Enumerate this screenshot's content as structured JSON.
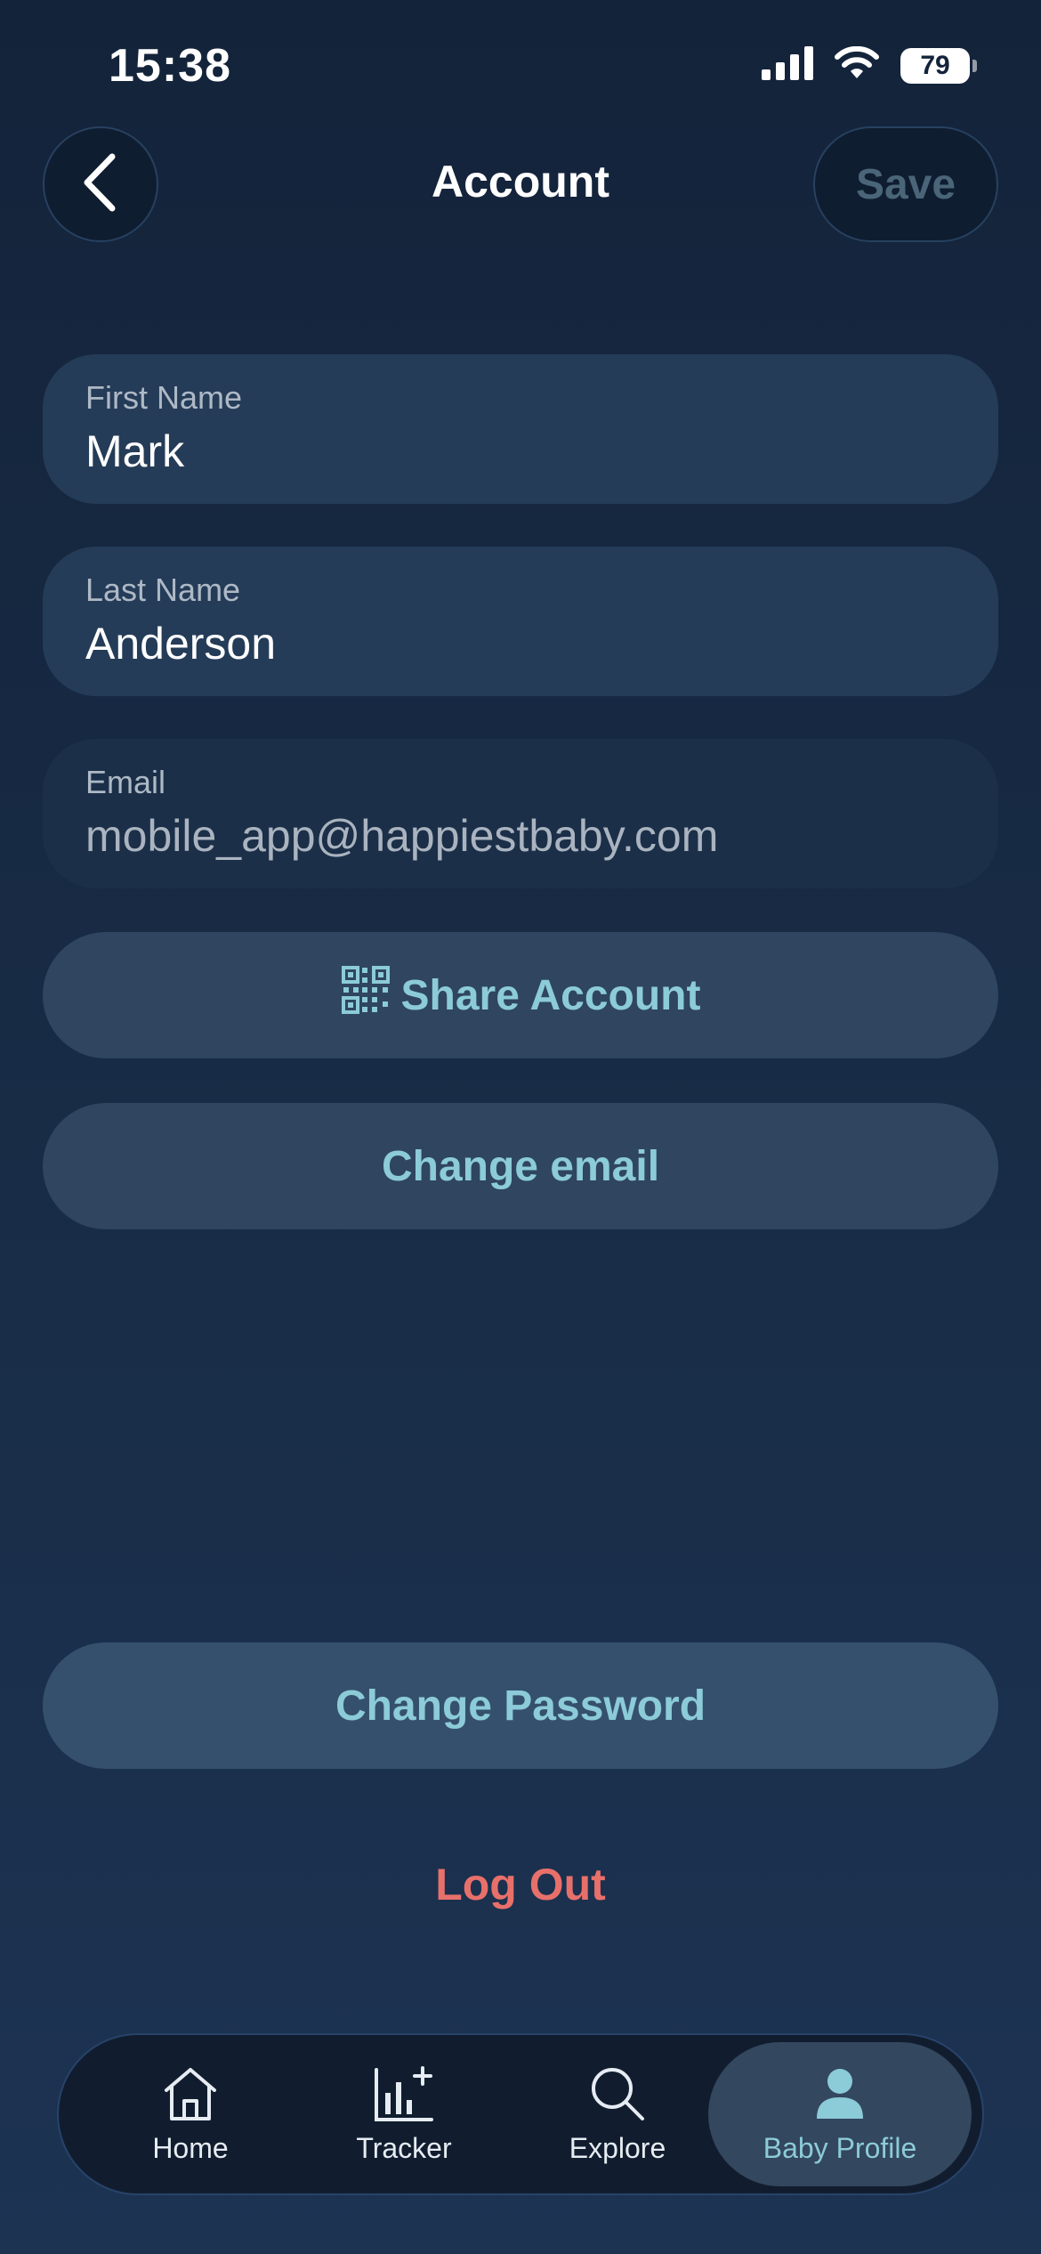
{
  "status_bar": {
    "time": "15:38",
    "battery": "79",
    "icons": [
      "cellular-signal-icon",
      "wifi-icon",
      "battery-icon"
    ]
  },
  "header": {
    "title": "Account",
    "save_label": "Save",
    "back_icon": "chevron-left-icon"
  },
  "form": {
    "first_name": {
      "label": "First Name",
      "value": "Mark"
    },
    "last_name": {
      "label": "Last Name",
      "value": "Anderson"
    },
    "email": {
      "label": "Email",
      "value": "mobile_app@happiestbaby.com"
    }
  },
  "actions": {
    "share_account": "Share Account",
    "share_icon": "qr-code-icon",
    "change_email": "Change email",
    "change_password": "Change Password",
    "log_out": "Log Out"
  },
  "nav": {
    "items": [
      {
        "label": "Home",
        "icon": "home-icon"
      },
      {
        "label": "Tracker",
        "icon": "tracker-chart-icon"
      },
      {
        "label": "Explore",
        "icon": "search-icon"
      },
      {
        "label": "Baby Profile",
        "icon": "profile-icon",
        "active": true
      }
    ]
  },
  "colors": {
    "accent": "#8ccbd8",
    "danger": "#e8706b",
    "background": "#13233a"
  }
}
